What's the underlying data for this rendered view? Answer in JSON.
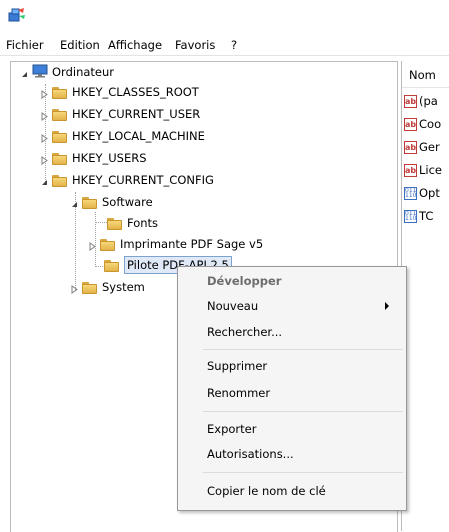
{
  "menubar": {
    "items": [
      {
        "label": "Fichier"
      },
      {
        "label": "Edition"
      },
      {
        "label": "Affichage"
      },
      {
        "label": "Favoris"
      },
      {
        "label": "?"
      }
    ]
  },
  "tree": {
    "root": "Ordinateur",
    "hives": [
      "HKEY_CLASSES_ROOT",
      "HKEY_CURRENT_USER",
      "HKEY_LOCAL_MACHINE",
      "HKEY_USERS",
      "HKEY_CURRENT_CONFIG"
    ],
    "software": "Software",
    "fonts": "Fonts",
    "imprimante": "Imprimante PDF Sage v5",
    "pilote": "Pilote PDF-API 2.5",
    "system": "System"
  },
  "values_pane": {
    "column_name": "Nom",
    "rows": [
      {
        "icon": "string-value-icon",
        "label": "(pa"
      },
      {
        "icon": "string-value-icon",
        "label": "Coo"
      },
      {
        "icon": "string-value-icon",
        "label": "Ger"
      },
      {
        "icon": "string-value-icon",
        "label": "Lice"
      },
      {
        "icon": "binary-value-icon",
        "label": "Opt"
      },
      {
        "icon": "binary-value-icon",
        "label": "TC"
      }
    ]
  },
  "context_menu": {
    "developper": "Développer",
    "nouveau": "Nouveau",
    "rechercher": "Rechercher...",
    "supprimer": "Supprimer",
    "renommer": "Renommer",
    "exporter": "Exporter",
    "autorisations": "Autorisations...",
    "copier": "Copier le nom de clé"
  }
}
